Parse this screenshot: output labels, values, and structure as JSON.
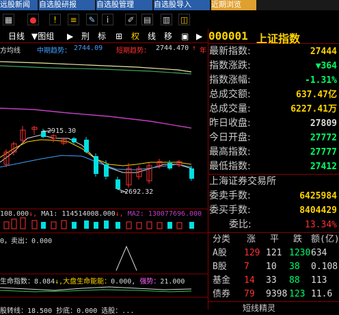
{
  "tabs": [
    {
      "label": "远股新闻"
    },
    {
      "label": "自选股研报"
    },
    {
      "label": "自选股管理"
    },
    {
      "label": "自选股导入"
    },
    {
      "label": "近期浏览"
    }
  ],
  "toolbar_icons": [
    "grid-icon",
    "ticker-icon",
    "alert-icon",
    "list-icon",
    "notes-icon",
    "info-icon",
    "edit-icon",
    "calc-icon",
    "table-icon",
    "chart-icon"
  ],
  "period": {
    "items": [
      "日线",
      "▼图组",
      "▶",
      "刑",
      "标",
      "⊞",
      "权",
      "线",
      "移",
      "▣",
      "□",
      "▶"
    ]
  },
  "chart_header": {
    "ma_label": "方均线",
    "mid_label": "中期趋势：",
    "mid_value": "2744.09",
    "short_label": "短期趋势：",
    "short_value": "2744.470",
    "arrow": "↑",
    "extra": "年"
  },
  "annotations": {
    "high": "2915.30",
    "low": "2692.32"
  },
  "volume_line": {
    "v": "108.000",
    "ma1_label": "MA1:",
    "ma1": "114514008.000",
    "ma2_label": "MA2:",
    "ma2": "130077696.000"
  },
  "sell_line": {
    "text": "0，卖出：0.000"
  },
  "life_line": {
    "a_label": "生命指数：",
    "a": "8.084",
    "b_label": "大盘生命能能：",
    "b": "0.000",
    "c_label": "强势：",
    "c": "21.000"
  },
  "bottom_line": {
    "a": "股转线：18.500",
    "b": "抄底：0.000",
    "c": "选股：..."
  },
  "quote": {
    "code": "000001",
    "name": "上证指数",
    "fields": [
      {
        "k": "最新指数:",
        "v": "27444",
        "color": "#ffd400"
      },
      {
        "k": "指数涨跌:",
        "v": "▼364",
        "color": "#00ff66"
      },
      {
        "k": "指数涨幅:",
        "v": "-1.31%",
        "color": "#00ff66"
      },
      {
        "k": "总成交额:",
        "v": "637.47亿",
        "color": "#ffd400"
      },
      {
        "k": "总成交量:",
        "v": "6227.41万",
        "color": "#ffd400"
      },
      {
        "k": "昨日收盘:",
        "v": "27809",
        "color": "#dddddd"
      },
      {
        "k": "今日开盘:",
        "v": "27772",
        "color": "#00ff66"
      },
      {
        "k": "最高指数:",
        "v": "27777",
        "color": "#00ff66"
      },
      {
        "k": "最低指数:",
        "v": "27412",
        "color": "#00ff66"
      }
    ],
    "exchange": "上海证券交易所",
    "buy_label": "委卖手数:",
    "buy_value": "6425984",
    "sell_label": "委买手数:",
    "sell_value": "8404429",
    "ratio_label": "委比:",
    "ratio_value": "13.34%"
  },
  "classify": {
    "headers": [
      "分类",
      "涨",
      "平",
      "跌",
      "额(亿)"
    ],
    "rows": [
      {
        "name": "A股",
        "up": "129",
        "flat": "121",
        "down": "1230",
        "amt": "634"
      },
      {
        "name": "B股",
        "up": "7",
        "flat": "10",
        "down": "38",
        "amt": "0.108"
      },
      {
        "name": "基金",
        "up": "14",
        "flat": "33",
        "down": "88",
        "amt": "113"
      },
      {
        "name": "债券",
        "up": "79",
        "flat": "9398",
        "down": "123",
        "amt": "11.6"
      }
    ],
    "footer": "短线精灵"
  },
  "colors": {
    "up": "#ff3030",
    "down": "#00e0e0",
    "accent": "#ffd400",
    "green": "#00ff66"
  }
}
